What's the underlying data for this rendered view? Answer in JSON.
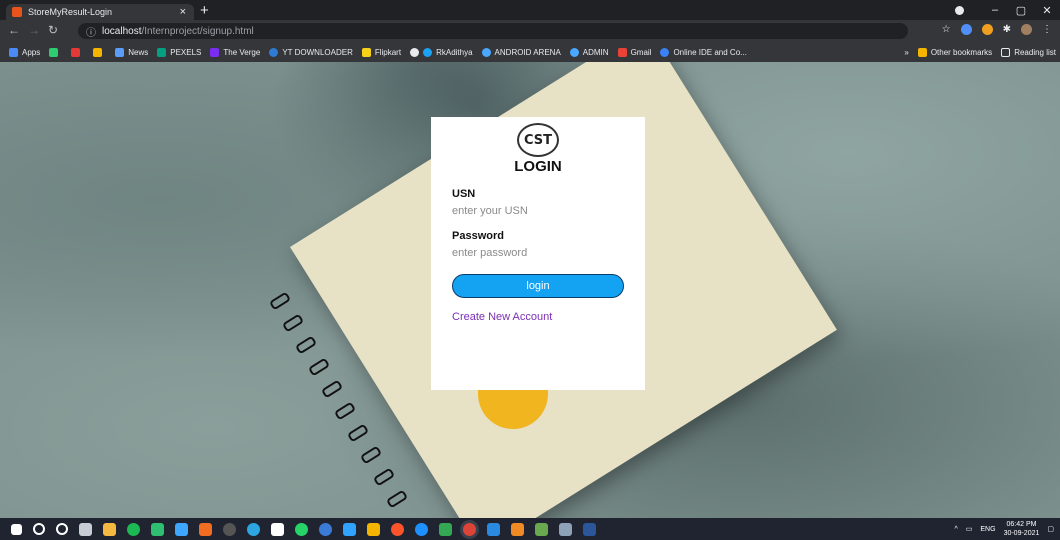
{
  "browser": {
    "tab_title": "StoreMyResult-Login",
    "tab_close": "×",
    "new_tab": "+",
    "url_host": "localhost",
    "url_path": "/Internproject/signup.html",
    "window_controls": {
      "minimize": "–",
      "maximize": "▢",
      "close": "✕"
    }
  },
  "bookmarks": {
    "items": [
      "Apps",
      "News",
      "PEXELS",
      "The Verge",
      "YT DOWNLOADER",
      "Flipkart",
      "RkAdithya",
      "ANDROID ARENA",
      "ADMIN",
      "Gmail",
      "Online IDE and Co..."
    ],
    "more": "»",
    "other": "Other bookmarks",
    "reading_list": "Reading list"
  },
  "login": {
    "logo_text": "CST",
    "title": "LOGIN",
    "usn_label": "USN",
    "usn_placeholder": "enter your USN",
    "password_label": "Password",
    "password_placeholder": "enter password",
    "button_label": "login",
    "create_account": "Create New Account"
  },
  "taskbar": {
    "language": "ENG",
    "time": "06:42 PM",
    "date": "30-09-2021"
  },
  "colors": {
    "button": "#14a2f2",
    "link": "#7b2fb5",
    "tab_favicon": "#e8541c"
  }
}
